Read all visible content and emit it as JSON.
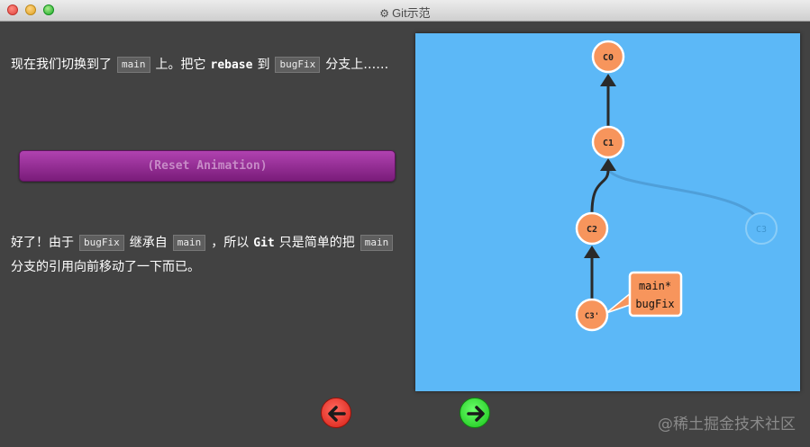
{
  "window": {
    "title": "Git示范"
  },
  "instructions": {
    "p1": {
      "t1": "现在我们切换到了",
      "c1": "main",
      "t2": "上。把它",
      "b1": "rebase",
      "t3": "到",
      "c2": "bugFix",
      "t4": "分支上……"
    },
    "p2": {
      "t1": "好了！由于",
      "c1": "bugFix",
      "t2": "继承自",
      "c2": "main",
      "t3": "，所以",
      "b1": "Git",
      "t4": "只是简单的把",
      "c3": "main",
      "t5": "分支的引用向前移动了一下而已。"
    },
    "reset_button": "(Reset Animation)"
  },
  "graph": {
    "commits": [
      "C0",
      "C1",
      "C2",
      "C3",
      "C3'"
    ],
    "branch_label": {
      "line1": "main*",
      "line2": "bugFix"
    },
    "colors": {
      "background": "#5cb8f7",
      "commit": "#f7955c",
      "ghost_commit": "#5cb8f7"
    }
  },
  "nav": {
    "back_icon": "arrow-left-icon",
    "forward_icon": "arrow-right-icon"
  },
  "watermark": "@稀土掘金技术社区"
}
